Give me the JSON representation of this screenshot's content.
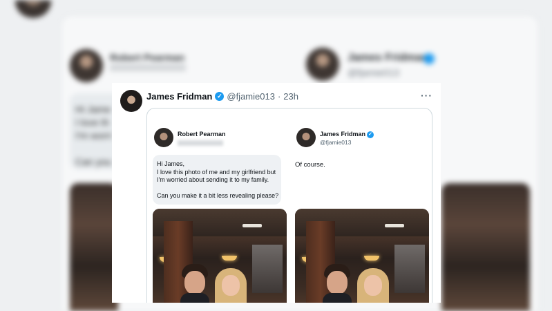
{
  "background": {
    "left_name": "Robert Pearman",
    "right_name": "James Fridman",
    "right_handle": "@fjamie013",
    "bubble_lines": [
      "Hi Jame",
      "I love th",
      "I'm worri",
      "Can you"
    ]
  },
  "tweet": {
    "author_name": "James Fridman",
    "author_handle": "@fjamie013",
    "separator": "·",
    "time": "23h",
    "more_icon": "more-horizontal-icon",
    "verified_color": "#1d9bf0",
    "left_panel": {
      "name": "Robert Pearman",
      "message_lines": [
        "Hi James,",
        "I love this photo of me and my girlfriend but",
        "I'm worried about sending it to my family.",
        "Can you make it a bit less revealing please?"
      ]
    },
    "right_panel": {
      "name": "James Fridman",
      "handle": "@fjamie013",
      "reply": "Of course."
    }
  }
}
